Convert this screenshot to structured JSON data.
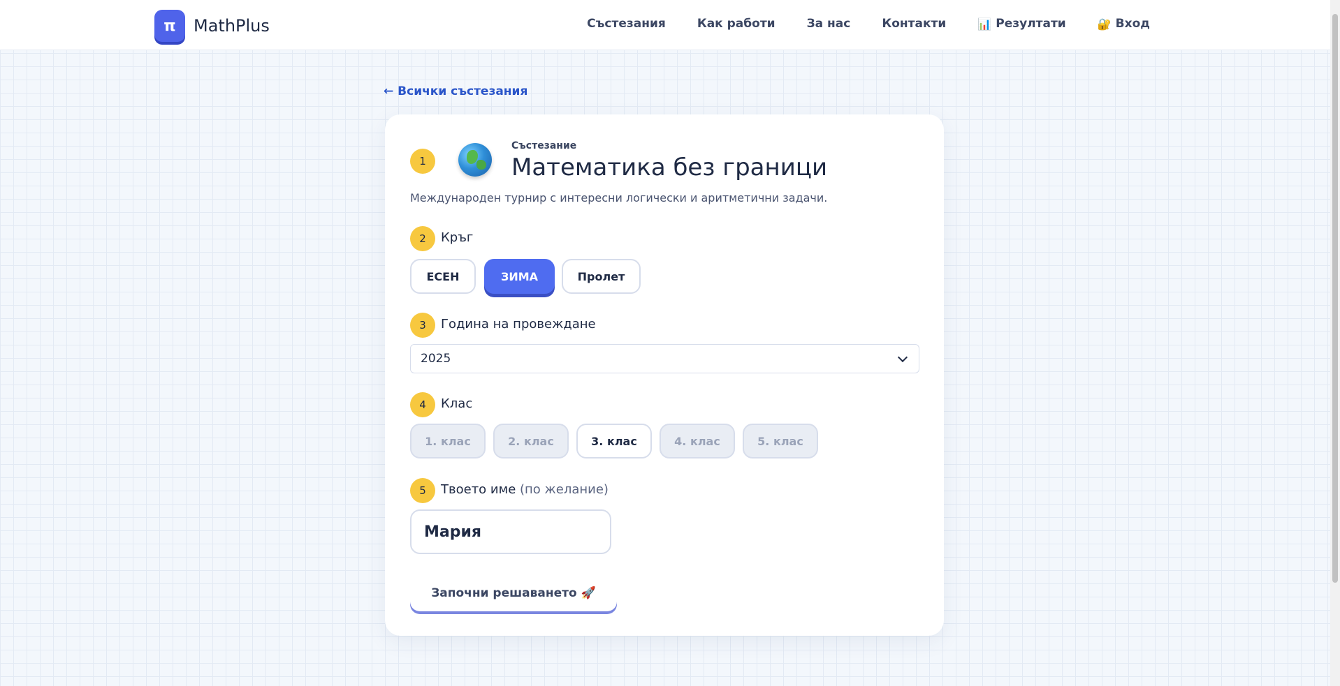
{
  "header": {
    "logo_mark": "π",
    "logo_text": "MathPlus",
    "nav": [
      {
        "label": "Състезания",
        "icon": ""
      },
      {
        "label": "Как работи",
        "icon": ""
      },
      {
        "label": "За нас",
        "icon": ""
      },
      {
        "label": "Контакти",
        "icon": ""
      },
      {
        "label": "Резултати",
        "icon": "📊"
      },
      {
        "label": "Вход",
        "icon": "🔐"
      }
    ]
  },
  "back_link": "← Всички състезания",
  "competition": {
    "step": "1",
    "icon": "globe-icon",
    "eyebrow": "Състезание",
    "title": "Математика без граници",
    "description": "Международен турнир с интересни логически и аритметични задачи."
  },
  "round": {
    "step": "2",
    "label": "Кръг",
    "options": [
      "ЕСЕН",
      "ЗИМА",
      "Пролет"
    ],
    "selected": "ЗИМА"
  },
  "year": {
    "step": "3",
    "label": "Година на провеждане",
    "value": "2025"
  },
  "grade": {
    "step": "4",
    "label": "Клас",
    "options": [
      "1. клас",
      "2. клас",
      "3. клас",
      "4. клас",
      "5. клас"
    ],
    "selected": "3. клас"
  },
  "name": {
    "step": "5",
    "label": "Твоето име",
    "hint": "(по желание)",
    "value": "Мария"
  },
  "start_button": "Започни решаването 🚀",
  "colors": {
    "accent": "#4f6cf0",
    "step_badge": "#f7c83f",
    "link": "#2a55c9"
  }
}
